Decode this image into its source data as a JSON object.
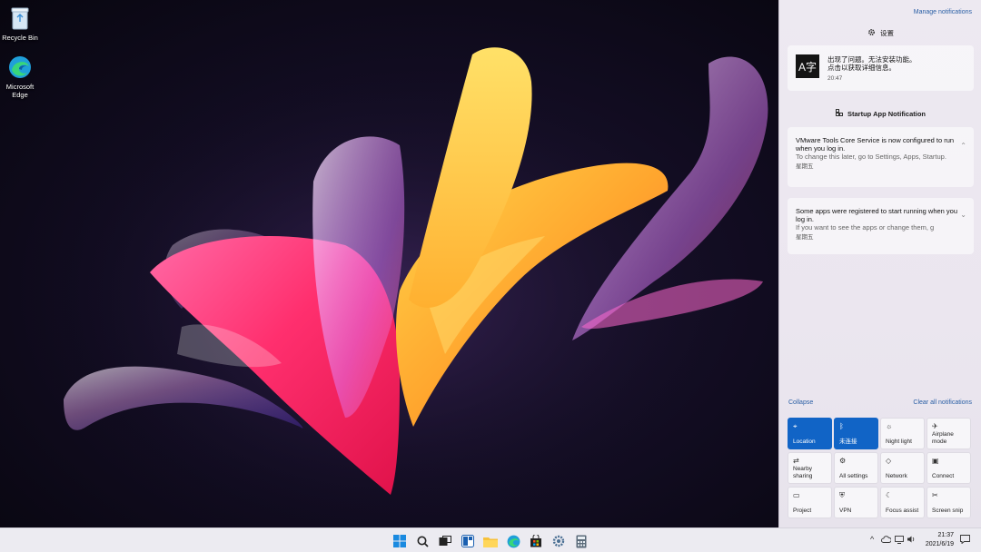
{
  "desktop": {
    "icons": [
      {
        "label": "Recycle Bin",
        "icon": "recycle-bin-icon"
      },
      {
        "label": "Microsoft\nEdge",
        "icon": "edge-icon"
      }
    ]
  },
  "notification_center": {
    "manage_label": "Manage notifications",
    "settings_group": {
      "title": "设置",
      "notification": {
        "tile_glyph": "A字",
        "line1": "出现了问题。无法安装功能。",
        "line2": "点击以获取详细信息。",
        "time": "20:47"
      }
    },
    "startup_group": {
      "title": "Startup App Notification",
      "notifications": [
        {
          "title": "VMware Tools Core Service is now configured to run when you log in.",
          "body": "To change this later, go to Settings, Apps, Startup.",
          "time": "星期五"
        },
        {
          "title": "Some apps were registered to start running when you log in.",
          "body": "If you want to see the apps or change them, g",
          "time": "星期五"
        }
      ]
    }
  },
  "quick_settings": {
    "collapse_label": "Collapse",
    "clear_label": "Clear all notifications",
    "tiles": [
      {
        "label": "Location",
        "icon": "location-icon",
        "active": true
      },
      {
        "label": "未连接",
        "icon": "bluetooth-icon",
        "active": true
      },
      {
        "label": "Night light",
        "icon": "night-light-icon",
        "active": false
      },
      {
        "label": "Airplane\nmode",
        "icon": "airplane-icon",
        "active": false
      },
      {
        "label": "Nearby\nsharing",
        "icon": "nearby-sharing-icon",
        "active": false
      },
      {
        "label": "All settings",
        "icon": "settings-icon",
        "active": false
      },
      {
        "label": "Network",
        "icon": "network-icon",
        "active": false
      },
      {
        "label": "Connect",
        "icon": "connect-icon",
        "active": false
      },
      {
        "label": "Project",
        "icon": "project-icon",
        "active": false
      },
      {
        "label": "VPN",
        "icon": "vpn-icon",
        "active": false
      },
      {
        "label": "Focus assist",
        "icon": "focus-assist-icon",
        "active": false
      },
      {
        "label": "Screen snip",
        "icon": "screen-snip-icon",
        "active": false
      }
    ]
  },
  "taskbar": {
    "apps": [
      "start-icon",
      "search-icon",
      "task-view-icon",
      "widgets-icon",
      "file-explorer-icon",
      "edge-icon",
      "store-icon",
      "settings-icon",
      "calculator-icon"
    ],
    "tray": {
      "chevron": "^",
      "time": "21:37",
      "date": "2021/6/19"
    }
  }
}
